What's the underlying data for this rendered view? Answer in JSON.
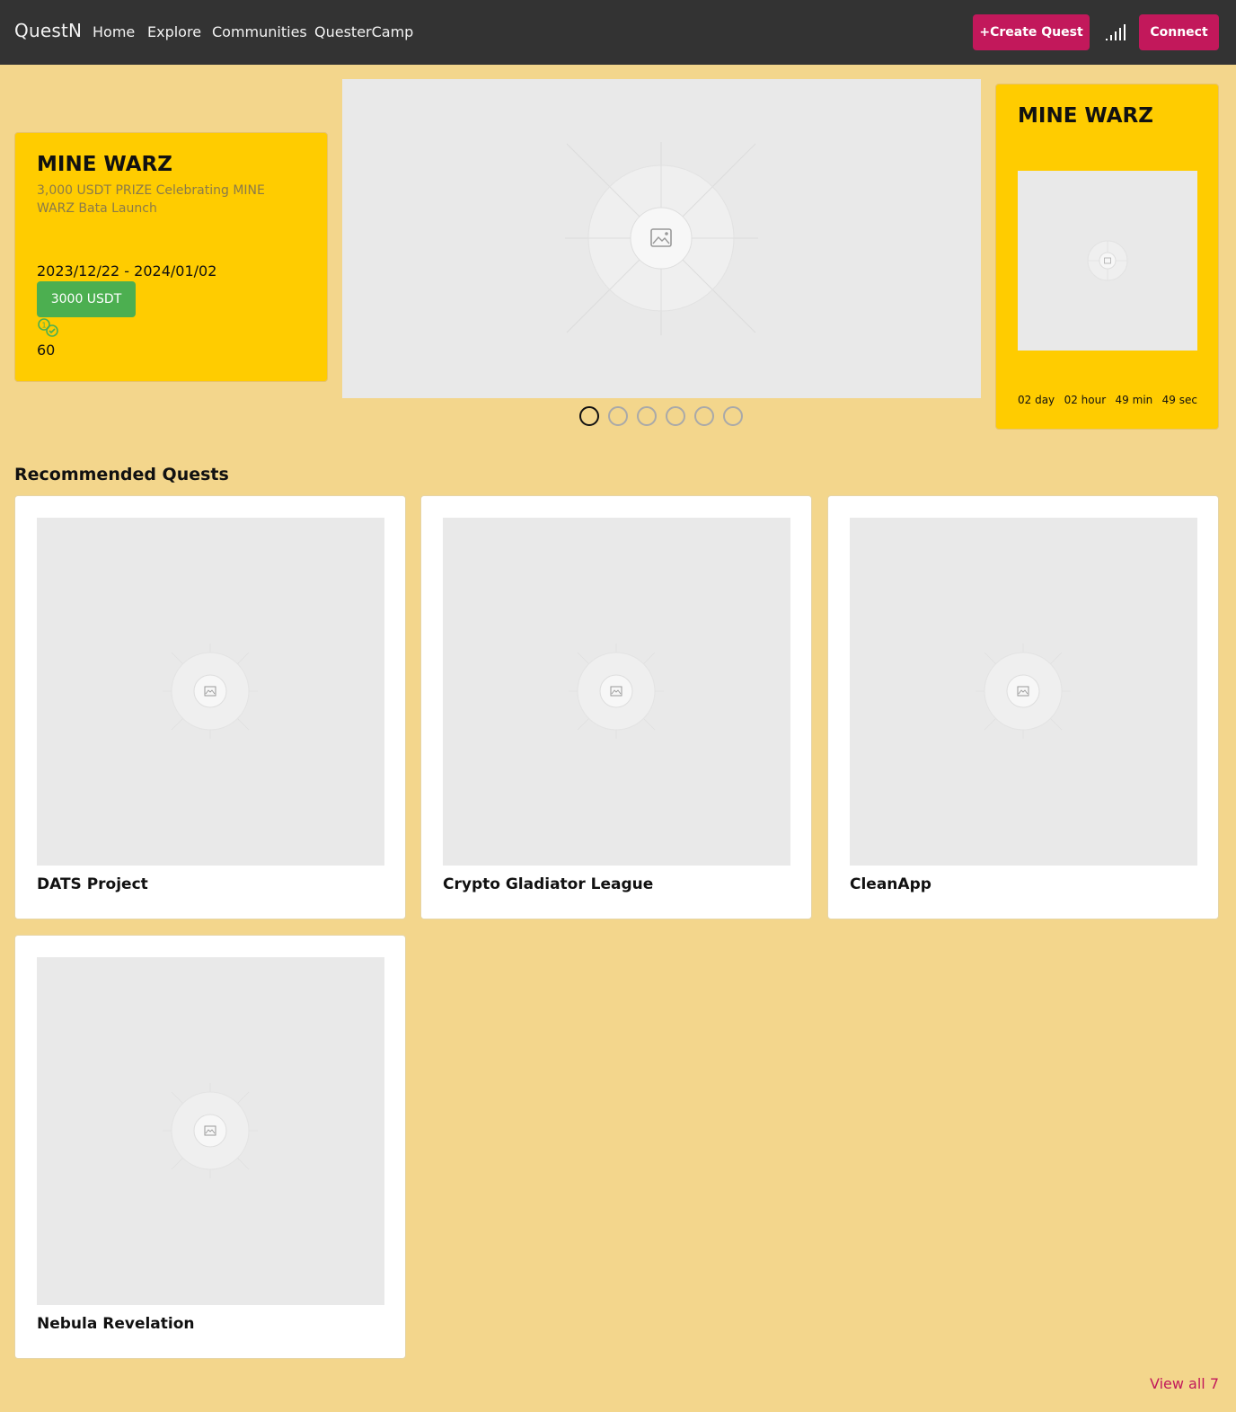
{
  "nav": {
    "brand": "QuestN",
    "links": [
      "Home",
      "Explore",
      "Communities",
      "QuesterCamp"
    ],
    "create_quest": "+Create Quest",
    "signal_icon": "signal-icon",
    "connect": "Connect"
  },
  "hero": {
    "left": {
      "title": "MINE WARZ",
      "description": "3,000 USDT PRIZE Celebrating MINE WARZ Bata Launch",
      "dates": "2023/12/22 - 2024/01/02",
      "reward": "3000 USDT",
      "reward_icon": "coins-icon",
      "participants": "60"
    },
    "banner_icon": "image-placeholder-icon",
    "slides_count": 6,
    "active_slide": 0,
    "right": {
      "title": "MINE WARZ",
      "countdown": [
        "02 day",
        "02 hour",
        "49 min",
        "49 sec"
      ]
    }
  },
  "recommended": {
    "title": "Recommended Quests",
    "quests": [
      {
        "name": "DATS Project"
      },
      {
        "name": "Crypto Gladiator League"
      },
      {
        "name": "CleanApp"
      },
      {
        "name": "Nebula Revelation"
      }
    ],
    "view_all": "View all 7"
  },
  "colors": {
    "page_bg": "#f3d68c",
    "nav_bg": "#333333",
    "accent": "#c2185b",
    "card_yellow": "#ffcc00",
    "reward_green": "#4caf50"
  }
}
